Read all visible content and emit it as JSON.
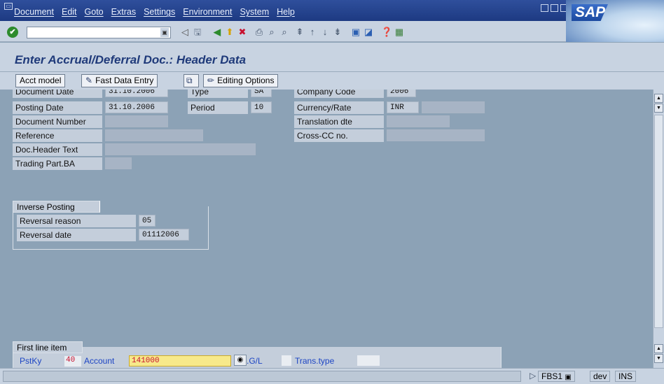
{
  "menubar": {
    "items": [
      "Document",
      "Edit",
      "Goto",
      "Extras",
      "Settings",
      "Environment",
      "System",
      "Help"
    ]
  },
  "brand": {
    "logo_text": "SAP"
  },
  "toolbar": {
    "command_field_value": "",
    "icons": [
      "enter-icon",
      "save-icon",
      "back-icon",
      "exit-icon",
      "cancel-icon",
      "print-icon",
      "find-icon",
      "find-next-icon",
      "first-page-icon",
      "previous-page-icon",
      "next-page-icon",
      "last-page-icon",
      "create-session-icon",
      "shortcut-icon",
      "help-icon",
      "layout-icon"
    ]
  },
  "page": {
    "title": "Enter Accrual/Deferral Doc.: Header Data"
  },
  "app_toolbar": {
    "acct_model": "Acct model",
    "fast_data_entry": "Fast Data Entry",
    "editing_options": "Editing Options"
  },
  "header": {
    "document_date_label": "Document Date",
    "document_date_value": "31.10.2006",
    "type_label": "Type",
    "type_value": "SA",
    "company_code_label": "Company Code",
    "company_code_value": "2006",
    "posting_date_label": "Posting Date",
    "posting_date_value": "31.10.2006",
    "period_label": "Period",
    "period_value": "10",
    "currency_label": "Currency/Rate",
    "currency_value": "INR",
    "rate_value": "",
    "document_number_label": "Document Number",
    "document_number_value": "",
    "translation_label": "Translation dte",
    "translation_value": "",
    "reference_label": "Reference",
    "reference_value": "",
    "cross_cc_label": "Cross-CC no.",
    "cross_cc_value": "",
    "doc_header_text_label": "Doc.Header Text",
    "doc_header_text_value": "",
    "trading_part_label": "Trading Part.BA",
    "trading_part_value": ""
  },
  "inverse_posting": {
    "title": "Inverse Posting",
    "reversal_reason_label": "Reversal reason",
    "reversal_reason_value": "05",
    "reversal_date_label": "Reversal date",
    "reversal_date_value": "01112006"
  },
  "first_line_item": {
    "title": "First line item",
    "pstky_label": "PstKy",
    "pstky_value": "40",
    "account_label": "Account",
    "account_value": "141000",
    "gl_label": ".G/L",
    "trans_type_label": "Trans.type",
    "trans_type_value": ""
  },
  "status": {
    "transaction": "FBS1",
    "system": "dev",
    "mode": "INS"
  },
  "colors": {
    "menubar": "#2f4f9c",
    "background": "#8ca2b6",
    "title_text": "#1f3a7a",
    "account_highlight": "#f7e98a",
    "pstky_value": "#c8102e"
  }
}
